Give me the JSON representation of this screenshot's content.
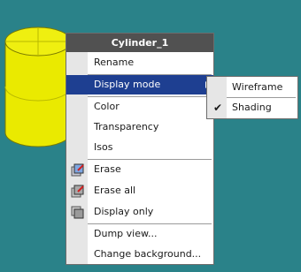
{
  "colors": {
    "background": "#2a8289",
    "cylinder": "#eaea00",
    "menu_title_bg": "#515151",
    "selection": "#1e3f91"
  },
  "context_menu": {
    "title": "Cylinder_1",
    "items": [
      {
        "label": "Rename"
      },
      {
        "label": "Display mode",
        "has_submenu": true,
        "highlighted": true
      },
      {
        "label": "Color"
      },
      {
        "label": "Transparency"
      },
      {
        "label": "Isos"
      },
      {
        "label": "Erase",
        "icon": "erase-icon"
      },
      {
        "label": "Erase all",
        "icon": "erase-all-icon"
      },
      {
        "label": "Display only",
        "icon": "display-only-icon"
      },
      {
        "label": "Dump view..."
      },
      {
        "label": "Change background..."
      }
    ]
  },
  "display_mode_submenu": {
    "items": [
      {
        "label": "Wireframe",
        "checked": false
      },
      {
        "label": "Shading",
        "checked": true
      }
    ]
  }
}
